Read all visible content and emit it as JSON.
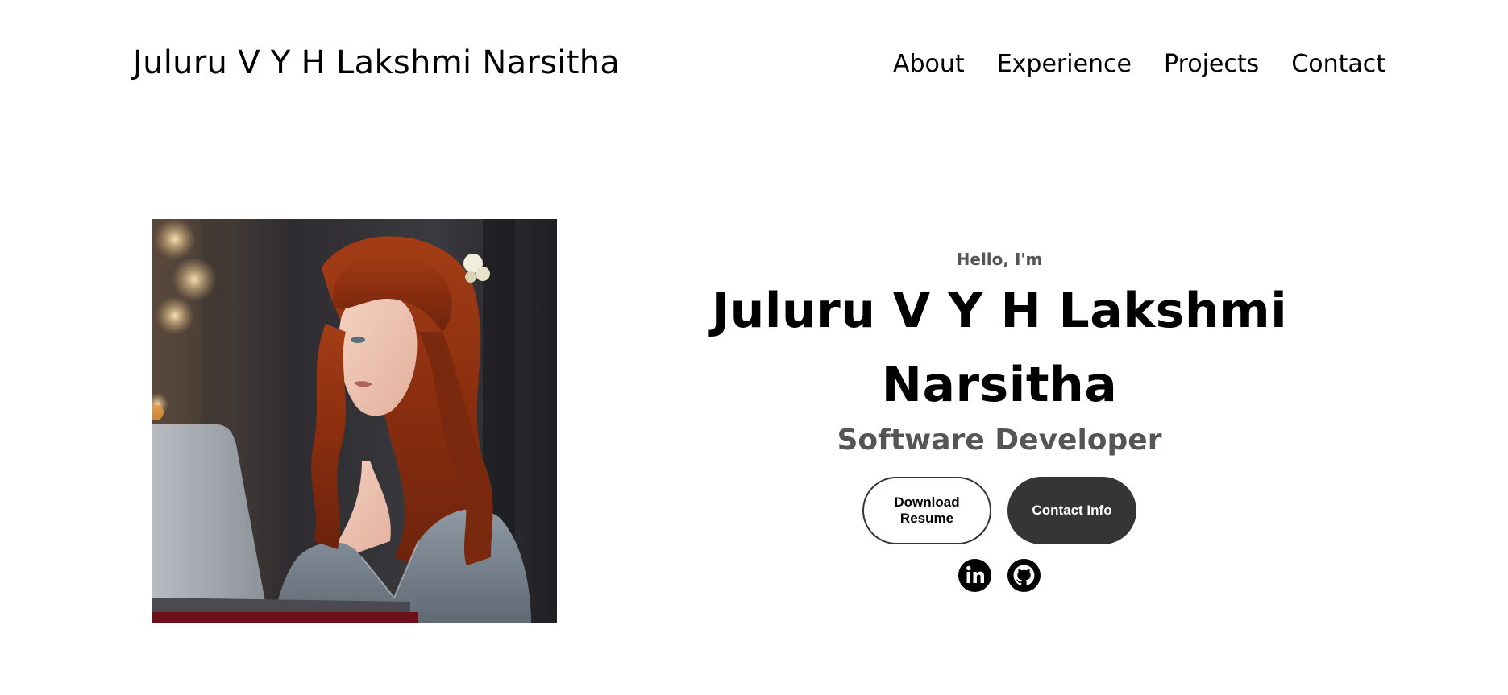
{
  "nav": {
    "logo": "Juluru V Y H Lakshmi Narsitha",
    "links": [
      {
        "label": "About"
      },
      {
        "label": "Experience"
      },
      {
        "label": "Projects"
      },
      {
        "label": "Contact"
      }
    ]
  },
  "profile": {
    "image_alt": "Profile picture"
  },
  "hero": {
    "greeting": "Hello, I'm",
    "name": "Juluru V Y H Lakshmi Narsitha",
    "title": "Software Developer",
    "buttons": {
      "download_resume": "Download Resume",
      "contact_info": "Contact Info"
    },
    "socials": [
      {
        "icon": "linkedin-icon"
      },
      {
        "icon": "github-icon"
      }
    ]
  },
  "colors": {
    "text": "#000000",
    "muted": "#555555",
    "button_dark": "#353535",
    "background": "#ffffff"
  }
}
